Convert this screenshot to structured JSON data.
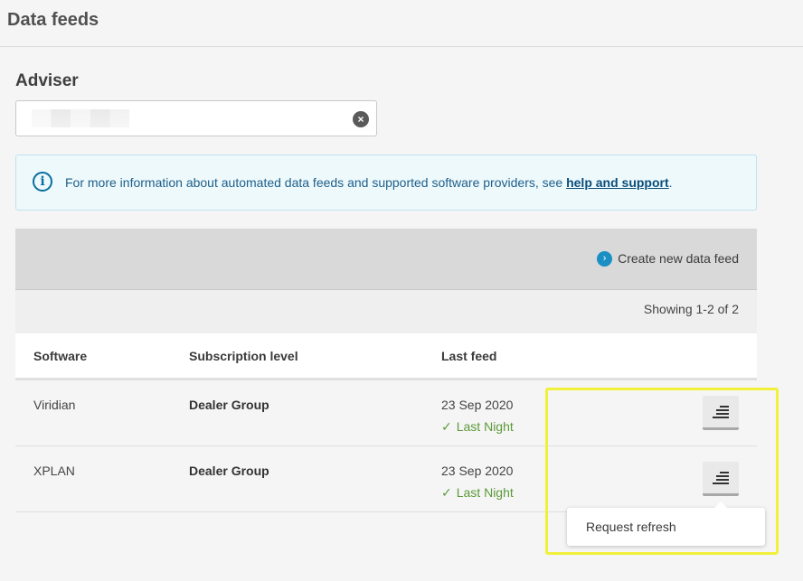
{
  "page": {
    "title": "Data feeds"
  },
  "adviser": {
    "label": "Adviser",
    "value": "",
    "clear_icon": "close-circle-icon"
  },
  "info": {
    "icon": "info-icon",
    "text": "For more information about automated data feeds and supported software providers, see ",
    "link_text": "help and support",
    "suffix": "."
  },
  "toolbar": {
    "create_label": "Create new data feed",
    "create_icon": "chevron-right-circle-icon"
  },
  "count": {
    "text": "Showing 1-2 of 2"
  },
  "table": {
    "columns": [
      "Software",
      "Subscription level",
      "Last feed"
    ],
    "rows": [
      {
        "software": "Viridian",
        "subscription": "Dealer Group",
        "date": "23 Sep 2020",
        "status": "Last Night"
      },
      {
        "software": "XPLAN",
        "subscription": "Dealer Group",
        "date": "23 Sep 2020",
        "status": "Last Night"
      }
    ]
  },
  "popup": {
    "item": "Request refresh"
  },
  "colors": {
    "accent": "#1a8fc4",
    "success": "#5c9a3a",
    "highlight": "#f1f03b",
    "info_bg": "#eef9fc"
  }
}
